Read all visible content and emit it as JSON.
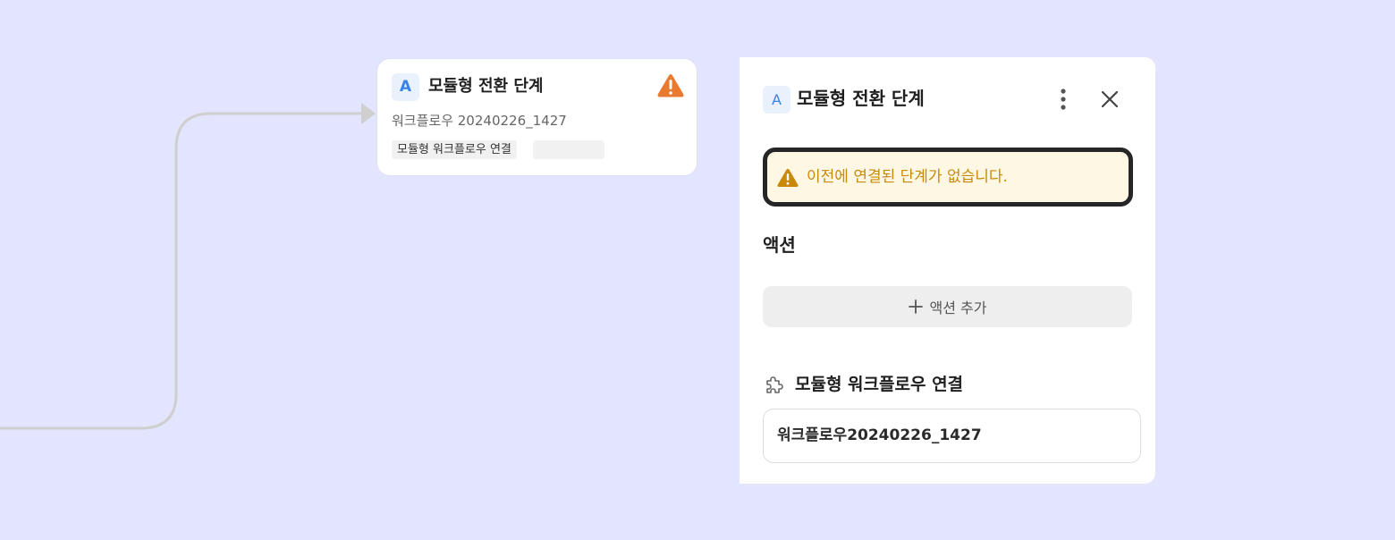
{
  "node": {
    "badge": "A",
    "title": "모듈형 전환 단계",
    "subtitle": "워크플로우 20240226_1427",
    "tag": "모듈형 워크플로우 연결",
    "warning_icon": "warning-triangle-icon"
  },
  "panel": {
    "badge": "A",
    "title": "모듈형 전환 단계",
    "alert_text": "이전에 연결된 단계가 없습니다.",
    "actions_heading": "액션",
    "add_action_label": "액션 추가",
    "module_heading": "모듈형 워크플로우 연결",
    "module_value": "워크플로우20240226_1427"
  },
  "colors": {
    "canvas_bg": "#e3e4fd",
    "accent_blue": "#3b82e6",
    "warning_orange": "#ea7a2f",
    "alert_text": "#c98a0a",
    "alert_bg": "#fef7e4"
  }
}
